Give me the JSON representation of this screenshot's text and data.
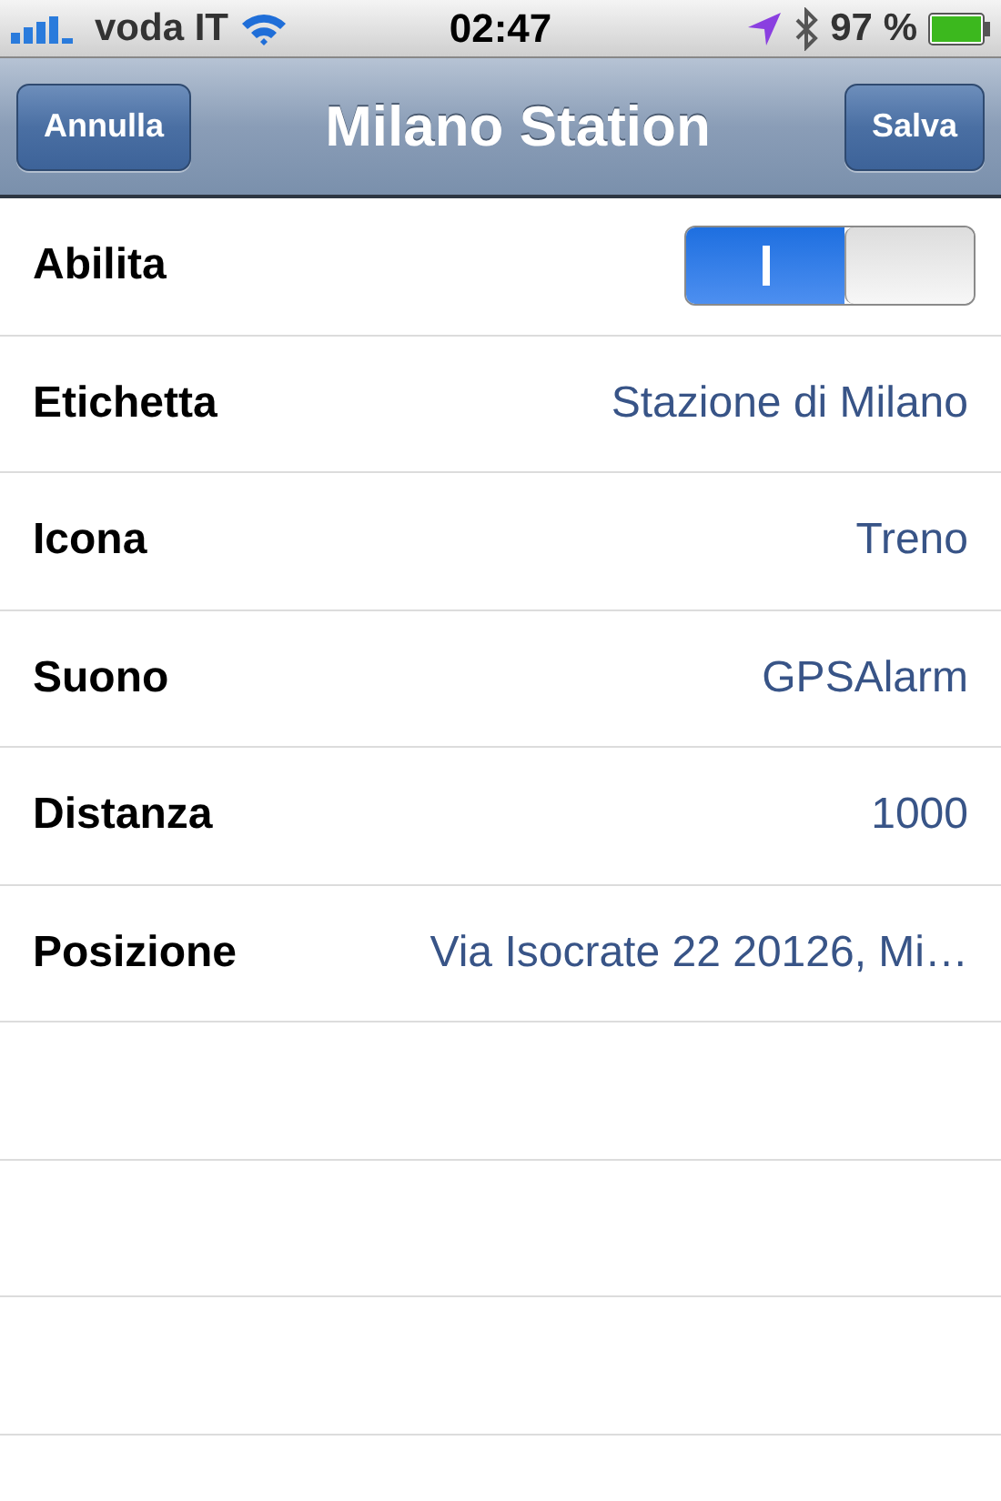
{
  "status_bar": {
    "carrier": "voda IT",
    "time": "02:47",
    "battery": "97 %"
  },
  "nav_bar": {
    "title": "Milano Station",
    "left_button": "Annulla",
    "right_button": "Salva"
  },
  "rows": [
    {
      "kind": "toggle",
      "label": "Abilita",
      "on": true
    },
    {
      "kind": "value",
      "label": "Etichetta",
      "value": "Stazione di Milano"
    },
    {
      "kind": "value",
      "label": "Icona",
      "value": "Treno"
    },
    {
      "kind": "value",
      "label": "Suono",
      "value": "GPSAlarm"
    },
    {
      "kind": "value",
      "label": "Distanza",
      "value": "1000"
    },
    {
      "kind": "value",
      "label": "Posizione",
      "value": "Via Isocrate 22 20126, Mi…"
    }
  ]
}
